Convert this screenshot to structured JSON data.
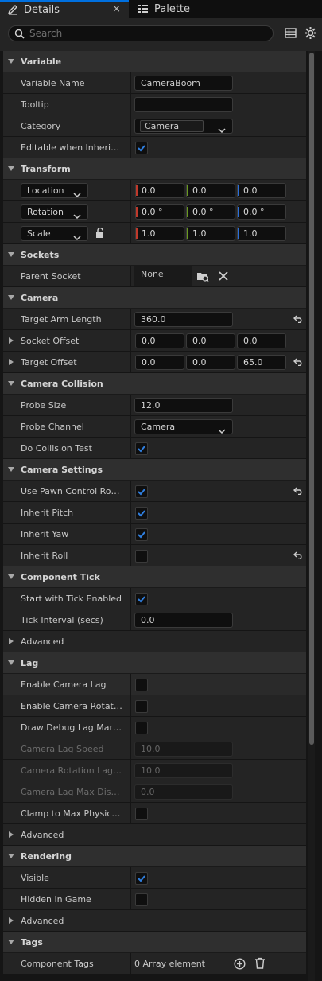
{
  "tabs": {
    "details": "Details",
    "palette": "Palette",
    "close": "×"
  },
  "search": {
    "placeholder": "Search"
  },
  "sections": {
    "variable": "Variable",
    "transform": "Transform",
    "sockets": "Sockets",
    "camera": "Camera",
    "camera_collision": "Camera Collision",
    "camera_settings": "Camera Settings",
    "component_tick": "Component Tick",
    "lag": "Lag",
    "rendering": "Rendering",
    "tags": "Tags"
  },
  "variable": {
    "name_label": "Variable Name",
    "name_value": "CameraBoom",
    "tooltip_label": "Tooltip",
    "tooltip_value": "",
    "category_label": "Category",
    "category_value": "Camera",
    "editable_label": "Editable when Inherited",
    "editable_checked": true
  },
  "transform": {
    "location": {
      "mode": "Location",
      "x": "0.0",
      "y": "0.0",
      "z": "0.0"
    },
    "rotation": {
      "mode": "Rotation",
      "x": "0.0 °",
      "y": "0.0 °",
      "z": "0.0 °"
    },
    "scale": {
      "mode": "Scale",
      "x": "1.0",
      "y": "1.0",
      "z": "1.0"
    }
  },
  "sockets": {
    "parent_label": "Parent Socket",
    "parent_value": "None"
  },
  "camera": {
    "arm_label": "Target Arm Length",
    "arm_value": "360.0",
    "socket_offset_label": "Socket Offset",
    "socket_offset": [
      "0.0",
      "0.0",
      "0.0"
    ],
    "target_offset_label": "Target Offset",
    "target_offset": [
      "0.0",
      "0.0",
      "65.0"
    ]
  },
  "collision": {
    "probe_size_label": "Probe Size",
    "probe_size_value": "12.0",
    "probe_channel_label": "Probe Channel",
    "probe_channel_value": "Camera",
    "do_test_label": "Do Collision Test",
    "do_test_checked": true
  },
  "camera_settings": {
    "use_pawn_label": "Use Pawn Control Rotation",
    "use_pawn_checked": true,
    "pitch_label": "Inherit Pitch",
    "pitch_checked": true,
    "yaw_label": "Inherit Yaw",
    "yaw_checked": true,
    "roll_label": "Inherit Roll",
    "roll_checked": false
  },
  "tick": {
    "start_label": "Start with Tick Enabled",
    "start_checked": true,
    "interval_label": "Tick Interval (secs)",
    "interval_value": "0.0",
    "advanced_label": "Advanced"
  },
  "lag": {
    "enable_label": "Enable Camera Lag",
    "enable_rot_label": "Enable Camera Rotation Lag",
    "debug_label": "Draw Debug Lag Markers",
    "lag_speed_label": "Camera Lag Speed",
    "lag_speed_value": "10.0",
    "rot_speed_label": "Camera Rotation Lag Speed",
    "rot_speed_value": "10.0",
    "max_dist_label": "Camera Lag Max Distance",
    "max_dist_value": "0.0",
    "clamp_label": "Clamp to Max Physics Delta Time",
    "advanced_label": "Advanced"
  },
  "rendering": {
    "visible_label": "Visible",
    "visible_checked": true,
    "hidden_label": "Hidden in Game",
    "hidden_checked": false,
    "advanced_label": "Advanced"
  },
  "tags": {
    "component_label": "Component Tags",
    "component_value": "0 Array element"
  },
  "colors": {
    "accent": "#0070e0",
    "x_axis": "#c0392b",
    "y_axis": "#6a9a1f",
    "z_axis": "#2a6fdb",
    "check": "#2f7fe0"
  }
}
